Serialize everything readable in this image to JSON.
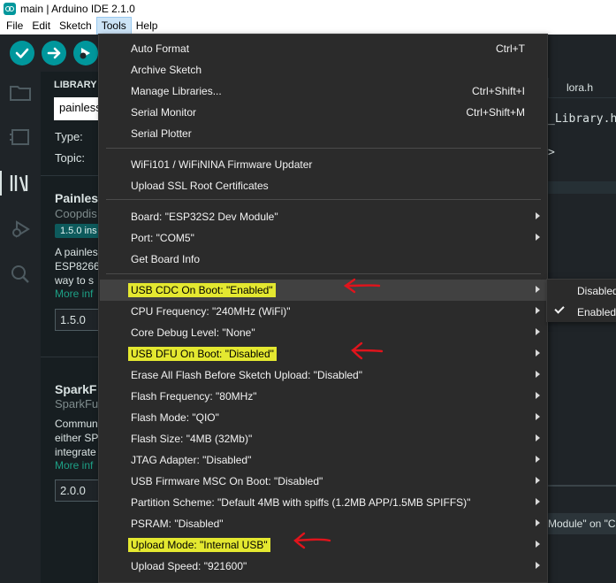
{
  "window": {
    "title": "main | Arduino IDE 2.1.0"
  },
  "menubar": {
    "items": [
      "File",
      "Edit",
      "Sketch",
      "Tools",
      "Help"
    ],
    "active": "Tools"
  },
  "toolbar": {
    "verify_icon": "check-icon",
    "upload_icon": "arrow-right-icon",
    "debug_icon": "debug-icon"
  },
  "library_panel": {
    "heading": "LIBRARY",
    "search_value": "painless",
    "type_label": "Type:",
    "topic_label": "Topic:",
    "libs": [
      {
        "name": "Painles",
        "author": "Coopdis",
        "badge": "1.5.0 ins",
        "desc": [
          "A painles",
          "ESP8266",
          "way to s"
        ],
        "more": "More inf",
        "version": "1.5.0"
      },
      {
        "name": "SparkF",
        "author": "SparkFu",
        "desc": [
          "Commun",
          "either SP",
          "integrate"
        ],
        "more": "More inf",
        "version": "2.0.0"
      }
    ]
  },
  "editor": {
    "tab": "lora.h",
    "code_lines": [
      "_Library.h",
      ">"
    ],
    "status": "Module\" on \"CO"
  },
  "tools_menu": {
    "items": [
      {
        "label": "Auto Format",
        "shortcut": "Ctrl+T"
      },
      {
        "label": "Archive Sketch"
      },
      {
        "label": "Manage Libraries...",
        "shortcut": "Ctrl+Shift+I"
      },
      {
        "label": "Serial Monitor",
        "shortcut": "Ctrl+Shift+M"
      },
      {
        "label": "Serial Plotter"
      },
      {
        "label": "WiFi101 / WiFiNINA Firmware Updater"
      },
      {
        "label": "Upload SSL Root Certificates"
      },
      {
        "label": "Board: \"ESP32S2 Dev Module\"",
        "submenu": true
      },
      {
        "label": "Port: \"COM5\"",
        "submenu": true
      },
      {
        "label": "Get Board Info"
      },
      {
        "label": "USB CDC On Boot: \"Enabled\"",
        "submenu": true,
        "highlighted": true,
        "hover": true
      },
      {
        "label": "CPU Frequency: \"240MHz (WiFi)\"",
        "submenu": true
      },
      {
        "label": "Core Debug Level: \"None\"",
        "submenu": true
      },
      {
        "label": "USB DFU On Boot: \"Disabled\"",
        "submenu": true,
        "highlighted": true
      },
      {
        "label": "Erase All Flash Before Sketch Upload: \"Disabled\"",
        "submenu": true
      },
      {
        "label": "Flash Frequency: \"80MHz\"",
        "submenu": true
      },
      {
        "label": "Flash Mode: \"QIO\"",
        "submenu": true
      },
      {
        "label": "Flash Size: \"4MB (32Mb)\"",
        "submenu": true
      },
      {
        "label": "JTAG Adapter: \"Disabled\"",
        "submenu": true
      },
      {
        "label": "USB Firmware MSC On Boot: \"Disabled\"",
        "submenu": true
      },
      {
        "label": "Partition Scheme: \"Default 4MB with spiffs (1.2MB APP/1.5MB SPIFFS)\"",
        "submenu": true
      },
      {
        "label": "PSRAM: \"Disabled\"",
        "submenu": true
      },
      {
        "label": "Upload Mode: \"Internal USB\"",
        "submenu": true,
        "highlighted": true
      },
      {
        "label": "Upload Speed: \"921600\"",
        "submenu": true
      }
    ]
  },
  "submenu": {
    "items": [
      {
        "label": "Disabled",
        "checked": false
      },
      {
        "label": "Enabled",
        "checked": true
      }
    ]
  },
  "colors": {
    "accent": "#00979c",
    "highlight": "#e4e830",
    "annotation": "#e0141c",
    "menu_bg": "#2b2b2b"
  }
}
